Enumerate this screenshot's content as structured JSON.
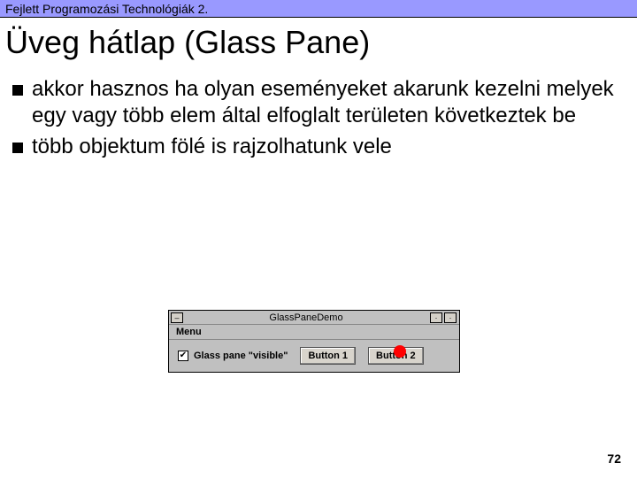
{
  "header": {
    "course": "Fejlett Programozási Technológiák 2."
  },
  "title": "Üveg hátlap (Glass Pane)",
  "bullets": [
    "akkor hasznos ha olyan eseményeket akarunk kezelni melyek egy vagy több elem által elfoglalt területen következtek be",
    "több objektum fölé is rajzolhatunk vele"
  ],
  "demo_window": {
    "title": "GlassPaneDemo",
    "menu_label": "Menu",
    "checkbox": {
      "checked": true,
      "label": "Glass pane \"visible\""
    },
    "buttons": [
      "Button 1",
      "Button 2"
    ],
    "minimize_glyph": "–",
    "maximize_glyph": "·",
    "close_glyph": "·",
    "check_glyph": "✔"
  },
  "page_number": "72"
}
